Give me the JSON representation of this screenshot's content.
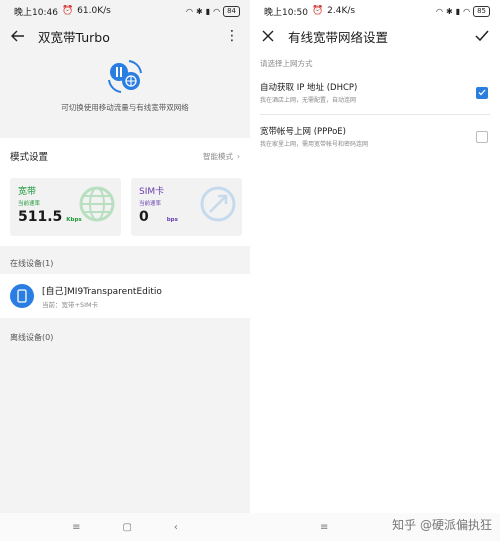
{
  "colors": {
    "accent": "#2a7de1",
    "broadband": "#1e9a3a",
    "sim": "#6a3db2"
  },
  "left": {
    "status": {
      "time": "晚上10:46",
      "speed": "61.0K/s",
      "battery": "84"
    },
    "title": "双宽带Turbo",
    "hero_desc": "可切换使用移动流量与有线宽带双网络",
    "mode": {
      "label": "模式设置",
      "value": "智能模式"
    },
    "broadband": {
      "name": "宽带",
      "sub": "当前速率",
      "value": "511.5",
      "unit": "Kbps"
    },
    "sim": {
      "name": "SIM卡",
      "sub": "当前速率",
      "value": "0",
      "unit": "bps"
    },
    "online_label": "在线设备(1)",
    "device": {
      "name": "[自己]MI9TransparentEditio",
      "sub": "当前：宽带+SIM卡"
    },
    "offline_label": "离线设备(0)"
  },
  "right": {
    "status": {
      "time": "晚上10:50",
      "speed": "2.4K/s",
      "battery": "85"
    },
    "title": "有线宽带网络设置",
    "prompt": "请选择上网方式",
    "options": [
      {
        "title": "自动获取 IP 地址 (DHCP)",
        "sub": "我在酒店上网，无需配置，自动连网",
        "checked": true
      },
      {
        "title": "宽带帐号上网 (PPPoE)",
        "sub": "我在家里上网，需用宽带帐号和密码连网",
        "checked": false
      }
    ],
    "watermark": "知乎 @硬派偏执狂"
  }
}
